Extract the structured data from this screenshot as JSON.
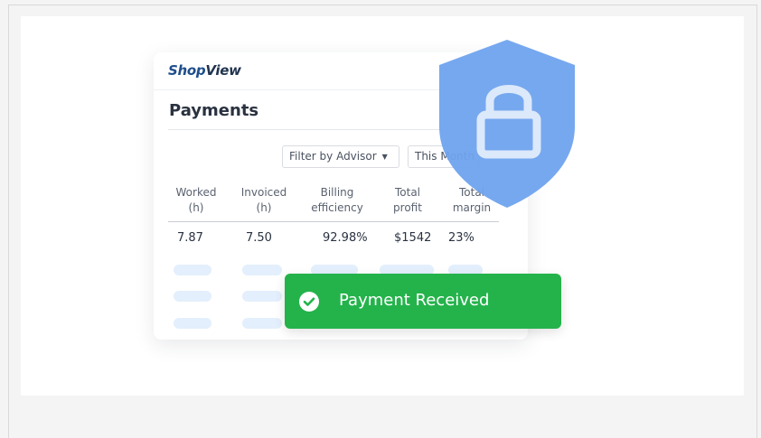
{
  "brand": {
    "logo_part1": "Shop",
    "logo_part2": "View"
  },
  "page": {
    "title": "Payments"
  },
  "filters": {
    "advisor": "Filter by Advisor",
    "period": "This Month"
  },
  "table": {
    "columns": [
      {
        "line1": "Worked",
        "line2": "(h)"
      },
      {
        "line1": "Invoiced",
        "line2": "(h)"
      },
      {
        "line1": "Billing",
        "line2": "efficiency"
      },
      {
        "line1": "Total",
        "line2": "profit"
      },
      {
        "line1": "Total",
        "line2": "margin"
      }
    ],
    "row": [
      "7.87",
      "7.50",
      "92.98%",
      "$1542",
      "23%"
    ]
  },
  "toast": {
    "message": "Payment Received"
  },
  "icons": {
    "shield": "shield-lock-icon",
    "toast": "check-circle-icon"
  },
  "colors": {
    "toast": "#24b34b",
    "shield": "#6fa3ee",
    "brand": "#1f4e8c"
  }
}
